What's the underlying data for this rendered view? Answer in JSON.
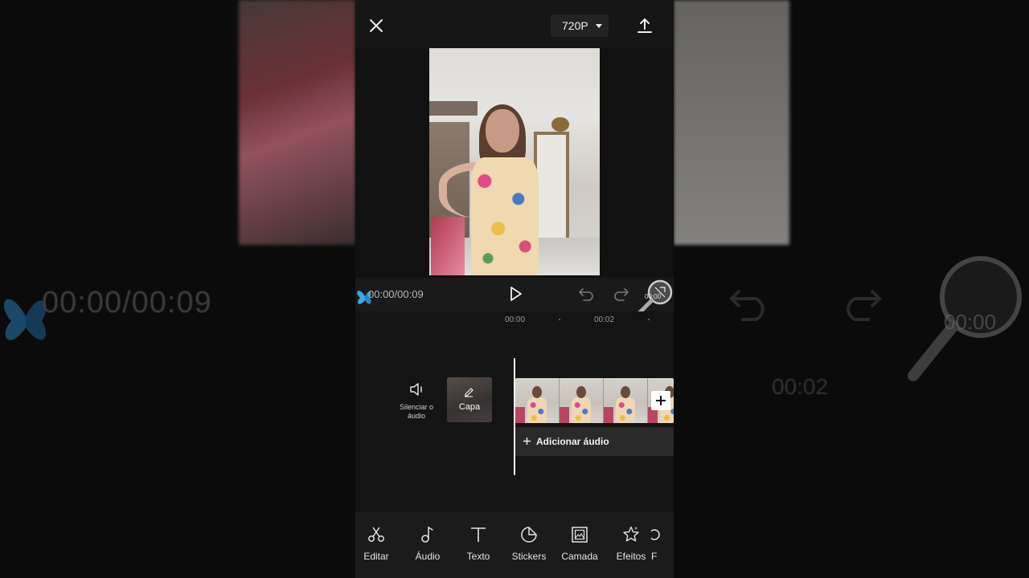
{
  "topbar": {
    "resolution_label": "720P"
  },
  "controls": {
    "time": "00:00/00:09",
    "fullscreen_label": "00:00"
  },
  "ruler": {
    "mark_0": "00:00",
    "mark_2": "00:02"
  },
  "timeline": {
    "mute_label": "Silenciar o áudio",
    "cover_label": "Capa",
    "add_audio_label": "Adicionar áudio",
    "frames": 4
  },
  "toolbar": {
    "items": [
      {
        "label": "Editar",
        "icon": "scissors-icon"
      },
      {
        "label": "Áudio",
        "icon": "music-note-icon"
      },
      {
        "label": "Texto",
        "icon": "text-icon"
      },
      {
        "label": "Stickers",
        "icon": "sticker-icon"
      },
      {
        "label": "Camada",
        "icon": "layer-icon"
      },
      {
        "label": "Efeitos",
        "icon": "effects-star-icon"
      },
      {
        "label": "F",
        "icon": "filter-icon"
      }
    ]
  },
  "background": {
    "time_text": "00:00/00:09",
    "tick_text": "00:02",
    "magnifier_text": "00:00"
  },
  "colors": {
    "app_bg": "#141414",
    "toolbar_bg": "#1b1b1b",
    "accent_white": "#ffffff",
    "butterfly_blue": "#3aa8e8"
  }
}
